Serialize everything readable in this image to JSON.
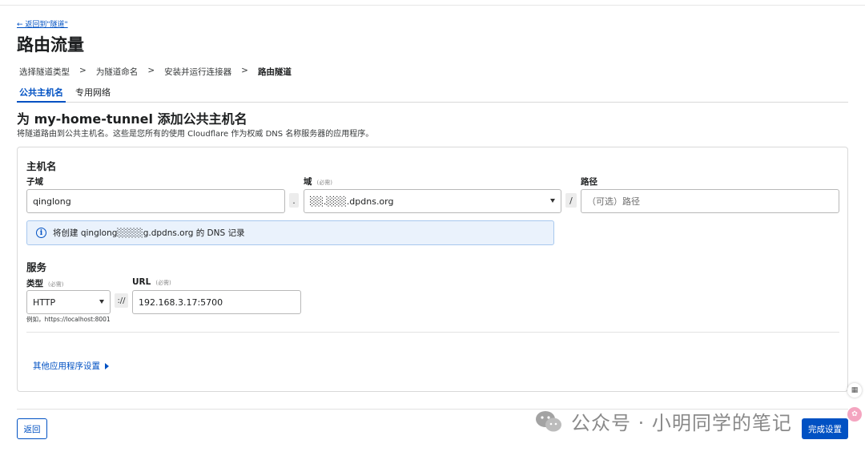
{
  "header": {
    "back_link": "← 返回到\"隧道\"",
    "title": "路由流量"
  },
  "breadcrumb": {
    "steps": [
      "选择隧道类型",
      "为隧道命名",
      "安装并运行连接器",
      "路由隧道"
    ],
    "separator": ">"
  },
  "tabs": [
    {
      "label": "公共主机名",
      "active": true
    },
    {
      "label": "专用网络",
      "active": false
    }
  ],
  "section": {
    "title": "为 my-home-tunnel 添加公共主机名",
    "description": "将隧道路由到公共主机名。这些是您所有的使用 Cloudflare 作为权威 DNS 名称服务器的应用程序。"
  },
  "hostname": {
    "heading": "主机名",
    "subdomain": {
      "label": "子域",
      "value": "qinglong"
    },
    "domain": {
      "label": "域",
      "required": "(必需)",
      "value": "░░.░░░.dpdns.org"
    },
    "dot": ".",
    "slash": "/",
    "path": {
      "label": "路径",
      "placeholder": "（可选）路径"
    },
    "info": "将创建 qinglong░░░░g.dpdns.org 的 DNS 记录"
  },
  "service": {
    "heading": "服务",
    "type": {
      "label": "类型",
      "required": "(必需)",
      "value": "HTTP",
      "hint": "例如，https://localhost:8001"
    },
    "scheme_sep": "://",
    "url": {
      "label": "URL",
      "required": "(必需)",
      "value": "192.168.3.17:5700"
    }
  },
  "more_settings": "其他应用程序设置",
  "footer": {
    "back_button": "返回",
    "done_button": "完成设置"
  },
  "watermark": "公众号 · 小明同学的笔记",
  "colors": {
    "accent": "#0051c3",
    "info_bg": "#eaf2fc"
  }
}
